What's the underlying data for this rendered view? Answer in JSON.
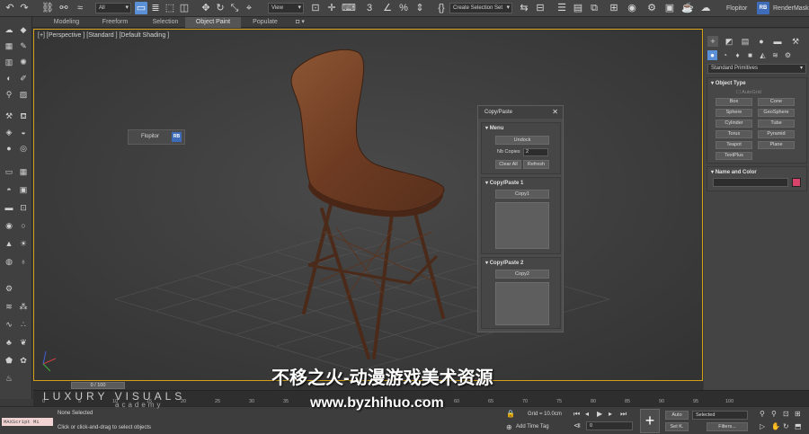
{
  "toolbar": {
    "filter_value": "All",
    "view_value": "View",
    "selection_set_value": "Create Selection Set",
    "flopitor_label": "Flopitor",
    "rb_badge": "RB",
    "rendermask_label": "RenderMask"
  },
  "ribbon": {
    "tabs": [
      {
        "label": "Modeling"
      },
      {
        "label": "Freeform"
      },
      {
        "label": "Selection"
      },
      {
        "label": "Object Paint"
      },
      {
        "label": "Populate"
      }
    ]
  },
  "viewport": {
    "label": "[+] [Perspective ] [Standard ] [Default Shading ]"
  },
  "flopitor_float": {
    "label": "Flopitor",
    "badge": "RB"
  },
  "copy_paste_panel": {
    "title": "Copy/Paste",
    "close": "✕",
    "menu": {
      "title": "Menu",
      "undock": "Undock",
      "nb_copies_label": "Nb Copies",
      "nb_copies_value": "2",
      "clear_all": "Clear All",
      "refresh": "Refresh"
    },
    "group1": {
      "title": "Copy/Paste 1",
      "button": "Copy1"
    },
    "group2": {
      "title": "Copy/Paste 2",
      "button": "Copy2"
    }
  },
  "command_panel": {
    "dropdown": "Standard Primitives",
    "object_type": {
      "title": "Object Type",
      "autogrid": "AutoGrid",
      "buttons": [
        "Box",
        "Cone",
        "Sphere",
        "GeoSphere",
        "Cylinder",
        "Tube",
        "Torus",
        "Pyramid",
        "Teapot",
        "Plane",
        "TextPlus"
      ]
    },
    "name_color": {
      "title": "Name and Color",
      "swatch_color": "#d9456a"
    }
  },
  "timeline": {
    "thumb": "0 / 100",
    "ticks": [
      "0",
      "5",
      "10",
      "15",
      "20",
      "25",
      "30",
      "35",
      "40",
      "45",
      "50",
      "55",
      "60",
      "65",
      "70",
      "75",
      "80",
      "85",
      "90",
      "95",
      "100"
    ]
  },
  "status": {
    "maxscript": "MAXScript Mi",
    "selection": "None Selected",
    "hint": "Click or click-and-drag to select objects",
    "grid": "Grid = 10.0cm",
    "add_time_tag": "Add Time Tag",
    "frame": "0",
    "auto": "Auto",
    "set_key": "Set K.",
    "selected": "Selected",
    "filters": "Filters..."
  },
  "watermark": {
    "logo": "LUXURY VISUALS",
    "sub": "academy",
    "cn": "不移之火-动漫游戏美术资源",
    "url": "www.byzhihuo.com"
  },
  "colors": {
    "accent": "#5b8fd6",
    "viewport_border": "#d4a017",
    "chair_seat": "#7a4428"
  }
}
